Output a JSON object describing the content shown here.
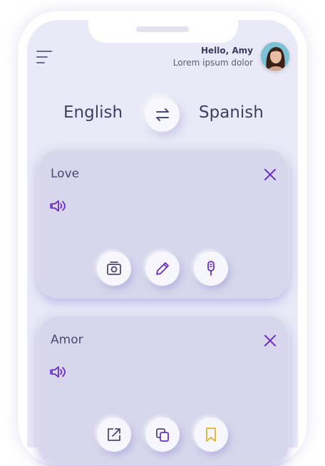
{
  "header": {
    "greeting": "Hello, Amy",
    "subtitle": "Lorem ipsum dolor",
    "menu_icon": "hamburger-menu-icon",
    "avatar": "user-avatar-photo"
  },
  "languages": {
    "from": "English",
    "to": "Spanish",
    "swap_icon": "swap-arrows-icon"
  },
  "cards": [
    {
      "text": "Love",
      "close_icon": "close-icon",
      "speaker_icon": "speaker-icon",
      "actions": [
        "camera-icon",
        "pencil-icon",
        "microphone-icon"
      ]
    },
    {
      "text": "Amor",
      "close_icon": "close-icon",
      "speaker_icon": "speaker-icon",
      "actions": [
        "share-icon",
        "copy-icon",
        "bookmark-icon"
      ]
    }
  ],
  "colors": {
    "accent": "#6a2fc6",
    "text_dark": "#3f3e63",
    "screen_bg": "#eae9f7",
    "card_bg": "#d8d6ec"
  }
}
